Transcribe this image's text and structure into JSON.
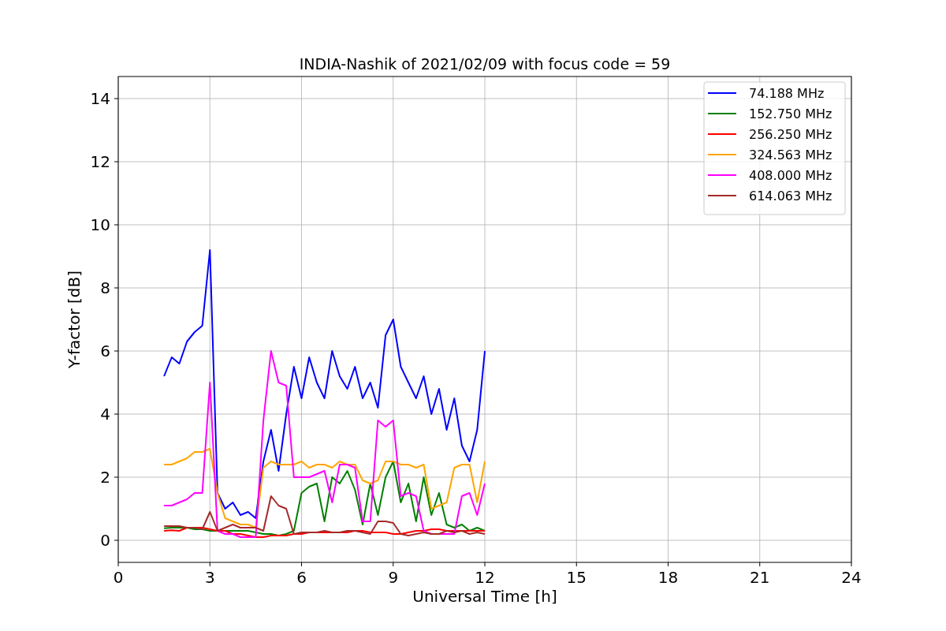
{
  "chart_data": {
    "type": "line",
    "title": "INDIA-Nashik of 2021/02/09 with focus code = 59",
    "xlabel": "Universal Time [h]",
    "ylabel": "Y-factor [dB]",
    "xlim": [
      0,
      24
    ],
    "ylim": [
      -0.7,
      14.7
    ],
    "xticks": [
      0,
      3,
      6,
      9,
      12,
      15,
      18,
      21,
      24
    ],
    "yticks": [
      0,
      2,
      4,
      6,
      8,
      10,
      12,
      14
    ],
    "grid": true,
    "legend": true,
    "x": [
      1.5,
      1.75,
      2,
      2.25,
      2.5,
      2.75,
      3,
      3.25,
      3.5,
      3.75,
      4,
      4.25,
      4.5,
      4.75,
      5,
      5.25,
      5.5,
      5.75,
      6,
      6.25,
      6.5,
      6.75,
      7,
      7.25,
      7.5,
      7.75,
      8,
      8.25,
      8.5,
      8.75,
      9,
      9.25,
      9.5,
      9.75,
      10,
      10.25,
      10.5,
      10.75,
      11,
      11.25,
      11.5,
      11.75,
      12
    ],
    "series": [
      {
        "name": "74.188 MHz",
        "color": "#0000ff",
        "values": [
          5.2,
          5.8,
          5.6,
          6.3,
          6.6,
          6.8,
          9.2,
          1.5,
          1.0,
          1.2,
          0.8,
          0.9,
          0.7,
          2.5,
          3.5,
          2.2,
          4.0,
          5.5,
          4.5,
          5.8,
          5.0,
          4.5,
          6.0,
          5.2,
          4.8,
          5.5,
          4.5,
          5.0,
          4.2,
          6.5,
          7.0,
          5.5,
          5.0,
          4.5,
          5.2,
          4.0,
          4.8,
          3.5,
          4.5,
          3.0,
          2.5,
          3.5,
          6.0
        ]
      },
      {
        "name": "152.750 MHz",
        "color": "#008000",
        "values": [
          0.38,
          0.4,
          0.4,
          0.4,
          0.35,
          0.35,
          0.3,
          0.3,
          0.3,
          0.3,
          0.3,
          0.3,
          0.25,
          0.2,
          0.2,
          0.15,
          0.2,
          0.3,
          1.5,
          1.7,
          1.8,
          0.6,
          2.0,
          1.8,
          2.2,
          1.6,
          0.5,
          1.8,
          0.8,
          2.0,
          2.5,
          1.2,
          1.8,
          0.6,
          2.0,
          0.8,
          1.5,
          0.5,
          0.4,
          0.5,
          0.3,
          0.4,
          0.3
        ]
      },
      {
        "name": "256.250 MHz",
        "color": "#ff0000",
        "values": [
          0.3,
          0.32,
          0.3,
          0.4,
          0.4,
          0.4,
          0.35,
          0.3,
          0.3,
          0.2,
          0.2,
          0.15,
          0.1,
          0.1,
          0.15,
          0.15,
          0.15,
          0.2,
          0.2,
          0.25,
          0.25,
          0.25,
          0.25,
          0.25,
          0.25,
          0.3,
          0.3,
          0.25,
          0.25,
          0.25,
          0.2,
          0.2,
          0.25,
          0.3,
          0.3,
          0.35,
          0.35,
          0.3,
          0.3,
          0.3,
          0.3,
          0.3,
          0.3
        ]
      },
      {
        "name": "324.563 MHz",
        "color": "#ffa500",
        "values": [
          2.4,
          2.4,
          2.5,
          2.6,
          2.8,
          2.8,
          2.9,
          1.5,
          0.7,
          0.6,
          0.5,
          0.5,
          0.4,
          2.3,
          2.5,
          2.4,
          2.4,
          2.4,
          2.5,
          2.3,
          2.4,
          2.4,
          2.3,
          2.5,
          2.4,
          2.4,
          1.9,
          1.8,
          1.9,
          2.5,
          2.5,
          2.4,
          2.4,
          2.3,
          2.4,
          1.0,
          1.1,
          1.2,
          2.3,
          2.4,
          2.4,
          1.2,
          2.5
        ]
      },
      {
        "name": "408.000 MHz",
        "color": "#ff00ff",
        "values": [
          1.1,
          1.1,
          1.2,
          1.3,
          1.5,
          1.5,
          5.0,
          0.3,
          0.2,
          0.2,
          0.1,
          0.1,
          0.1,
          3.8,
          6.0,
          5.0,
          4.9,
          2.0,
          2.0,
          2.0,
          2.1,
          2.2,
          1.2,
          2.4,
          2.4,
          2.3,
          0.6,
          0.6,
          3.8,
          3.6,
          3.8,
          1.4,
          1.5,
          1.4,
          0.3,
          0.2,
          0.2,
          0.2,
          0.2,
          1.4,
          1.5,
          0.8,
          1.8
        ]
      },
      {
        "name": "614.063 MHz",
        "color": "#a52a2a",
        "values": [
          0.45,
          0.45,
          0.45,
          0.4,
          0.4,
          0.35,
          0.9,
          0.3,
          0.4,
          0.5,
          0.4,
          0.4,
          0.4,
          0.3,
          1.4,
          1.1,
          1.0,
          0.2,
          0.25,
          0.25,
          0.25,
          0.3,
          0.25,
          0.25,
          0.3,
          0.3,
          0.25,
          0.2,
          0.6,
          0.6,
          0.55,
          0.2,
          0.15,
          0.2,
          0.25,
          0.2,
          0.2,
          0.3,
          0.25,
          0.3,
          0.2,
          0.25,
          0.2
        ]
      }
    ]
  }
}
